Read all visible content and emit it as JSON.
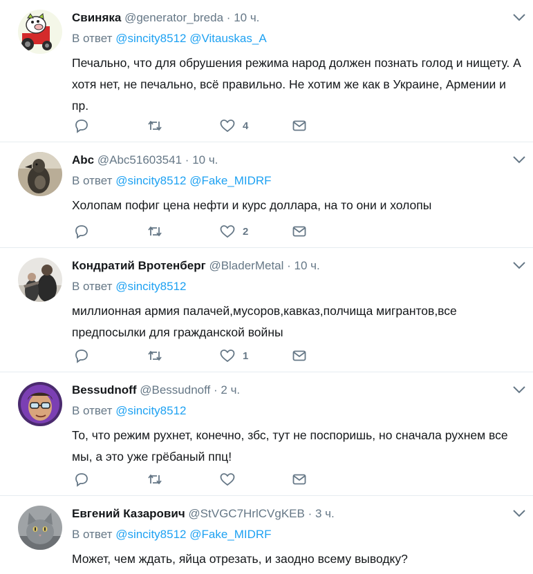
{
  "reply_prefix": "В ответ",
  "tweets": [
    {
      "name": "Свиняка",
      "handle": "@generator_breda",
      "dot": "·",
      "time": "10 ч.",
      "mentions": [
        "@sincity8512",
        "@Vitauskas_A"
      ],
      "text": "Печально, что для обрушения режима народ должен познать голод и нищету. А хотя нет, не печально, всё правильно. Не хотим же как в Украине, Армении и пр.",
      "reply_count": "",
      "retweet_count": "",
      "like_count": "4",
      "avatar_icon": "cartoon-pig-tractor-avatar"
    },
    {
      "name": "Abc",
      "handle": "@Abc51603541",
      "dot": "·",
      "time": "10 ч.",
      "mentions": [
        "@sincity8512",
        "@Fake_MIDRF"
      ],
      "text": "Холопам пофиг цена нефти и курс доллара, на то они и холопы",
      "reply_count": "",
      "retweet_count": "",
      "like_count": "2",
      "avatar_icon": "bird-photo-avatar"
    },
    {
      "name": "Кондратий Вротенберг",
      "handle": "@BladerMetal",
      "dot": "·",
      "time": "10 ч.",
      "mentions": [
        "@sincity8512"
      ],
      "text": "миллионная армия палачей,мусоров,кавказ,полчища мигрантов,все предпосылки для гражданской войны",
      "reply_count": "",
      "retweet_count": "",
      "like_count": "1",
      "avatar_icon": "people-photo-avatar"
    },
    {
      "name": "Bessudnoff",
      "handle": "@Bessudnoff",
      "dot": "·",
      "time": "2 ч.",
      "mentions": [
        "@sincity8512"
      ],
      "text": "То, что режим рухнет, конечно, збс, тут не поспоришь, но сначала рухнем все мы, а это уже грёбаный ппц!",
      "reply_count": "",
      "retweet_count": "",
      "like_count": "",
      "avatar_icon": "man-glasses-purple-avatar"
    },
    {
      "name": "Евгений Казарович",
      "handle": "@StVGC7HrlCVgKEB",
      "dot": "·",
      "time": "3 ч.",
      "mentions": [
        "@sincity8512",
        "@Fake_MIDRF"
      ],
      "text": "Может, чем ждать, яйца отрезать, и заодно всему выводку?",
      "reply_count": "",
      "retweet_count": "",
      "like_count": "",
      "avatar_icon": "gray-cat-avatar"
    }
  ]
}
